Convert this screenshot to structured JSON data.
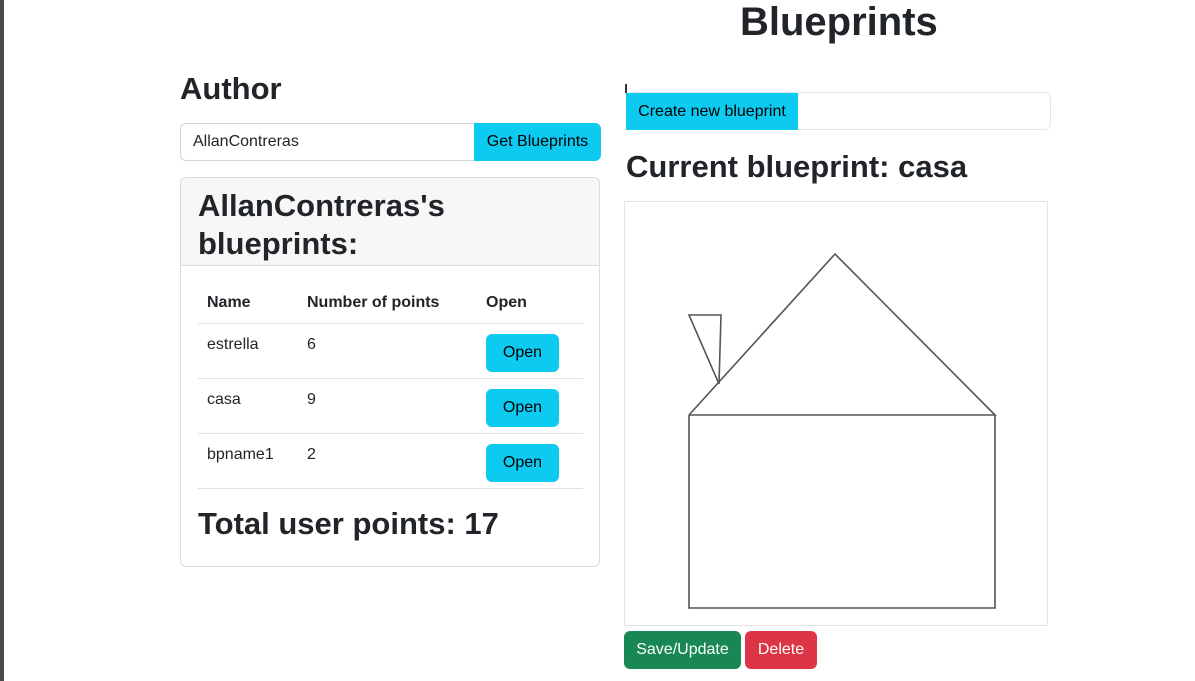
{
  "page": {
    "title": "Blueprints"
  },
  "author": {
    "heading": "Author",
    "input_value": "AllanContreras",
    "get_button": "Get Blueprints"
  },
  "blueprints_card": {
    "title": "AllanContreras's blueprints:",
    "columns": [
      "Name",
      "Number of points",
      "Open"
    ],
    "rows": [
      {
        "name": "estrella",
        "points": "6",
        "action": "Open"
      },
      {
        "name": "casa",
        "points": "9",
        "action": "Open"
      },
      {
        "name": "bpname1",
        "points": "2",
        "action": "Open"
      }
    ],
    "total": "Total user points: 17"
  },
  "editor": {
    "create_button": "Create new blueprint",
    "current_title": "Current blueprint: casa",
    "save_button": "Save/Update",
    "delete_button": "Delete",
    "stroke_color": "#555555"
  },
  "colors": {
    "info": "#0dcaf0",
    "success": "#198754",
    "danger": "#dc3545"
  }
}
